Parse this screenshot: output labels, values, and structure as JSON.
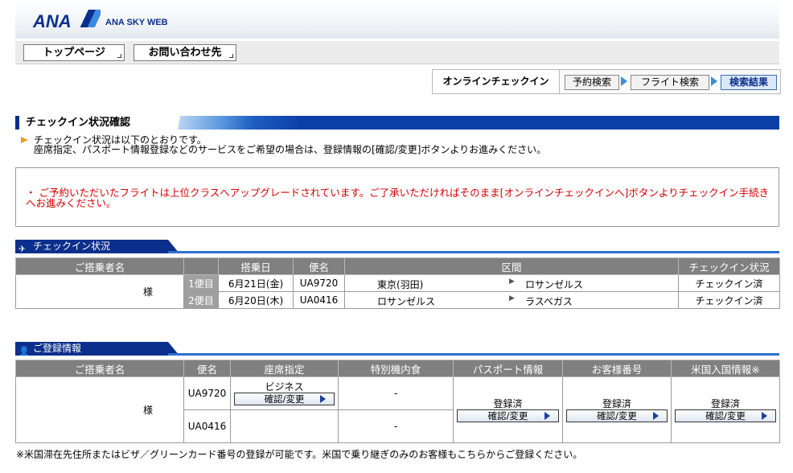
{
  "header": {
    "logo": "ANA",
    "brand": "ANA SKY WEB"
  },
  "nav": {
    "top": "トップページ",
    "contact": "お問い合わせ先"
  },
  "steps": {
    "title": "オンラインチェックイン",
    "items": [
      "予約検索",
      "フライト検索",
      "検索結果"
    ]
  },
  "section": {
    "title": "チェックイン状況確認"
  },
  "note": {
    "line1": "チェックイン状況は以下のとおりです。",
    "line2": "座席指定、パスポート情報登録などのサービスをご希望の場合は、登録情報の[確認/変更]ボタンよりお進みください。"
  },
  "alert": {
    "message": "・ ご予約いただいたフライトは上位クラスへアップグレードされています。ご了承いただければそのまま[オンラインチェックインへ]ボタンよりチェックイン手続きへお進みください。"
  },
  "checkin": {
    "heading": "チェックイン状況",
    "headers": {
      "passenger": "ご搭乗者名",
      "date": "搭乗日",
      "flight": "便名",
      "route": "区間",
      "status": "チェックイン状況"
    },
    "passenger_suffix": "様",
    "rows": [
      {
        "seg": "1便目",
        "date": "6月21日(金)",
        "flight": "UA9720",
        "from": "東京(羽田)",
        "to": "ロサンゼルス",
        "status": "チェックイン済"
      },
      {
        "seg": "2便目",
        "date": "6月20日(木)",
        "flight": "UA0416",
        "from": "ロサンゼルス",
        "to": "ラスベガス",
        "status": "チェックイン済"
      }
    ]
  },
  "registration": {
    "heading": "ご登録情報",
    "headers": {
      "passenger": "ご搭乗者名",
      "flight": "便名",
      "seat": "座席指定",
      "meal": "特別機内食",
      "passport": "パスポート情報",
      "customer": "お客様番号",
      "usentry": "米国入国情報※"
    },
    "passenger_suffix": "様",
    "rows": [
      {
        "flight": "UA9720",
        "seat": "ビジネス",
        "meal": "-"
      },
      {
        "flight": "UA0416",
        "seat": "",
        "meal": "-"
      }
    ],
    "registered": "登録済",
    "confirm_label": "確認/変更"
  },
  "footnote": "※米国滞在先住所またはビザ／グリーンカード番号の登録が可能です。米国で乗り継ぎのみのお客様もこちらからご登録ください。"
}
